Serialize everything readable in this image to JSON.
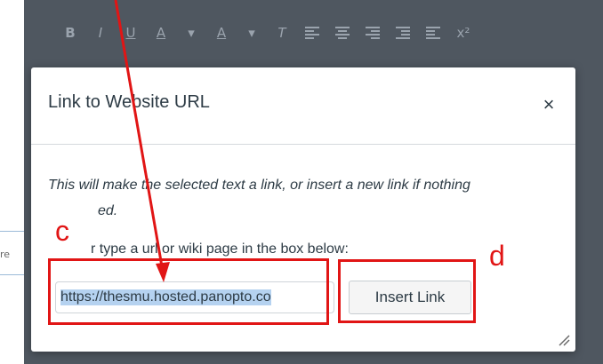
{
  "toolbar": {
    "bold": "B",
    "italic": "I",
    "underline": "U",
    "font_color": "A",
    "dropdown_caret": "▾",
    "highlight": "A",
    "clear_format": "T",
    "superscript": "x²"
  },
  "left_snippet": "re",
  "dialog": {
    "title": "Link to Website URL",
    "close": "×",
    "description_line1": "This will make the selected text a link, or insert a new link if nothing",
    "description_line2": "ed.",
    "instruction": "r type a url or wiki page in the box below:",
    "url_value": "https://thesmu.hosted.panopto.co",
    "insert_button": "Insert Link"
  },
  "annotations": {
    "label_c": "c",
    "label_d": "d"
  },
  "colors": {
    "annotation": "#e11515",
    "overlay": "#48505a",
    "text": "#2d3b45",
    "selection": "#b5d2f0"
  }
}
